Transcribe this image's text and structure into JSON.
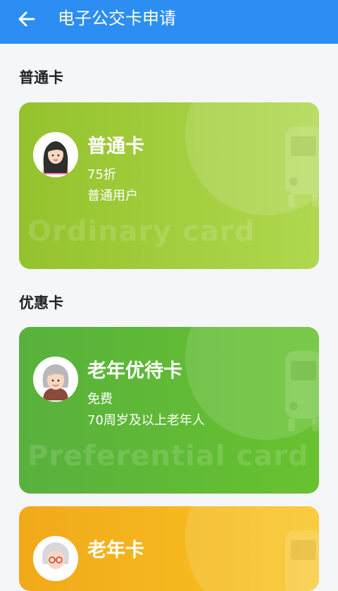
{
  "appbar": {
    "title": "电子公交卡申请",
    "back_icon": "arrow-left-icon",
    "color": "#2c8ef3"
  },
  "sections": [
    {
      "title": "普通卡"
    },
    {
      "title": "优惠卡"
    }
  ],
  "cards": [
    {
      "name": "普通卡",
      "line1": "75折",
      "line2": "普通用户",
      "watermark": "Ordinary card",
      "avatar": "girl-avatar-icon",
      "color": "#a2cd3e"
    },
    {
      "name": "老年优待卡",
      "line1": "免费",
      "line2": "70周岁及以上老年人",
      "watermark": "Preferential card",
      "avatar": "elderly-woman-avatar-icon",
      "color": "#5fb937"
    },
    {
      "name": "老年卡",
      "avatar": "elderly-grandma-avatar-icon",
      "color": "#f5b81f"
    }
  ]
}
